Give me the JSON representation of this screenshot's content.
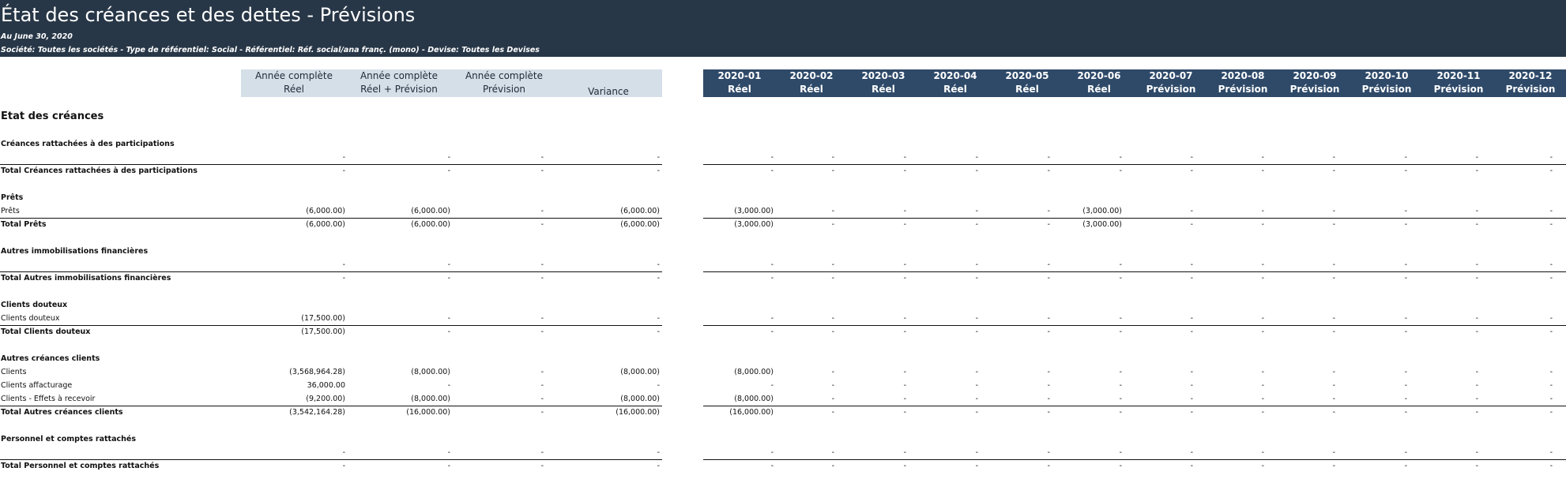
{
  "header": {
    "title": "État des créances et des dettes - Prévisions",
    "as_of": "Au June 30, 2020",
    "filters": "Société: Toutes les sociétés  - Type de référentiel: Social  - Référentiel: Réf. social/ana franç. (mono) - Devise: Toutes les Devises"
  },
  "summary_columns": [
    {
      "line1": "Année complète",
      "line2": "Réel"
    },
    {
      "line1": "Année complète",
      "line2": "Réel + Prévision"
    },
    {
      "line1": "Année complète",
      "line2": "Prévision"
    },
    {
      "line1": "",
      "line2": "Variance"
    }
  ],
  "month_columns": [
    {
      "period": "2020-01",
      "type": "Réel"
    },
    {
      "period": "2020-02",
      "type": "Réel"
    },
    {
      "period": "2020-03",
      "type": "Réel"
    },
    {
      "period": "2020-04",
      "type": "Réel"
    },
    {
      "period": "2020-05",
      "type": "Réel"
    },
    {
      "period": "2020-06",
      "type": "Réel"
    },
    {
      "period": "2020-07",
      "type": "Prévision"
    },
    {
      "period": "2020-08",
      "type": "Prévision"
    },
    {
      "period": "2020-09",
      "type": "Prévision"
    },
    {
      "period": "2020-10",
      "type": "Prévision"
    },
    {
      "period": "2020-11",
      "type": "Prévision"
    },
    {
      "period": "2020-12",
      "type": "Prévision"
    }
  ],
  "section_title": "Etat des créances",
  "rows": [
    {
      "kind": "group",
      "label": "Créances rattachées à des participations"
    },
    {
      "kind": "line",
      "label": "",
      "summary": [
        "-",
        "-",
        "-",
        "-"
      ],
      "months": [
        "-",
        "-",
        "-",
        "-",
        "-",
        "-",
        "-",
        "-",
        "-",
        "-",
        "-",
        "-"
      ]
    },
    {
      "kind": "total",
      "label": "Total Créances rattachées à des participations",
      "summary": [
        "-",
        "-",
        "-",
        "-"
      ],
      "months": [
        "-",
        "-",
        "-",
        "-",
        "-",
        "-",
        "-",
        "-",
        "-",
        "-",
        "-",
        "-"
      ]
    },
    {
      "kind": "group",
      "label": "Prêts"
    },
    {
      "kind": "line",
      "label": "Prêts",
      "summary": [
        "(6,000.00)",
        "(6,000.00)",
        "-",
        "(6,000.00)"
      ],
      "months": [
        "(3,000.00)",
        "-",
        "-",
        "-",
        "-",
        "(3,000.00)",
        "-",
        "-",
        "-",
        "-",
        "-",
        "-"
      ]
    },
    {
      "kind": "total",
      "label": "Total Prêts",
      "summary": [
        "(6,000.00)",
        "(6,000.00)",
        "-",
        "(6,000.00)"
      ],
      "months": [
        "(3,000.00)",
        "-",
        "-",
        "-",
        "-",
        "(3,000.00)",
        "-",
        "-",
        "-",
        "-",
        "-",
        "-"
      ]
    },
    {
      "kind": "group",
      "label": "Autres immobilisations financières"
    },
    {
      "kind": "line",
      "label": "",
      "summary": [
        "-",
        "-",
        "-",
        "-"
      ],
      "months": [
        "-",
        "-",
        "-",
        "-",
        "-",
        "-",
        "-",
        "-",
        "-",
        "-",
        "-",
        "-"
      ]
    },
    {
      "kind": "total",
      "label": "Total Autres immobilisations financières",
      "summary": [
        "-",
        "-",
        "-",
        "-"
      ],
      "months": [
        "-",
        "-",
        "-",
        "-",
        "-",
        "-",
        "-",
        "-",
        "-",
        "-",
        "-",
        "-"
      ]
    },
    {
      "kind": "group",
      "label": "Clients douteux"
    },
    {
      "kind": "line",
      "label": "Clients douteux",
      "summary": [
        "(17,500.00)",
        "-",
        "-",
        "-"
      ],
      "months": [
        "-",
        "-",
        "-",
        "-",
        "-",
        "-",
        "-",
        "-",
        "-",
        "-",
        "-",
        "-"
      ]
    },
    {
      "kind": "total",
      "label": "Total Clients douteux",
      "summary": [
        "(17,500.00)",
        "-",
        "-",
        "-"
      ],
      "months": [
        "-",
        "-",
        "-",
        "-",
        "-",
        "-",
        "-",
        "-",
        "-",
        "-",
        "-",
        "-"
      ]
    },
    {
      "kind": "group",
      "label": "Autres créances clients"
    },
    {
      "kind": "line",
      "label": "Clients",
      "summary": [
        "(3,568,964.28)",
        "(8,000.00)",
        "-",
        "(8,000.00)"
      ],
      "months": [
        "(8,000.00)",
        "-",
        "-",
        "-",
        "-",
        "-",
        "-",
        "-",
        "-",
        "-",
        "-",
        "-"
      ]
    },
    {
      "kind": "line",
      "label": "Clients affacturage",
      "summary": [
        "36,000.00",
        "-",
        "-",
        "-"
      ],
      "months": [
        "-",
        "-",
        "-",
        "-",
        "-",
        "-",
        "-",
        "-",
        "-",
        "-",
        "-",
        "-"
      ]
    },
    {
      "kind": "line",
      "label": "Clients - Effets à recevoir",
      "summary": [
        "(9,200.00)",
        "(8,000.00)",
        "-",
        "(8,000.00)"
      ],
      "months": [
        "(8,000.00)",
        "-",
        "-",
        "-",
        "-",
        "-",
        "-",
        "-",
        "-",
        "-",
        "-",
        "-"
      ]
    },
    {
      "kind": "total",
      "label": "Total Autres créances clients",
      "summary": [
        "(3,542,164.28)",
        "(16,000.00)",
        "-",
        "(16,000.00)"
      ],
      "months": [
        "(16,000.00)",
        "-",
        "-",
        "-",
        "-",
        "-",
        "-",
        "-",
        "-",
        "-",
        "-",
        "-"
      ]
    },
    {
      "kind": "group",
      "label": "Personnel et comptes rattachés"
    },
    {
      "kind": "line",
      "label": "",
      "summary": [
        "-",
        "-",
        "-",
        "-"
      ],
      "months": [
        "-",
        "-",
        "-",
        "-",
        "-",
        "-",
        "-",
        "-",
        "-",
        "-",
        "-",
        "-"
      ]
    },
    {
      "kind": "total",
      "label": "Total Personnel et comptes rattachés",
      "summary": [
        "-",
        "-",
        "-",
        "-"
      ],
      "months": [
        "-",
        "-",
        "-",
        "-",
        "-",
        "-",
        "-",
        "-",
        "-",
        "-",
        "-",
        "-"
      ]
    }
  ]
}
